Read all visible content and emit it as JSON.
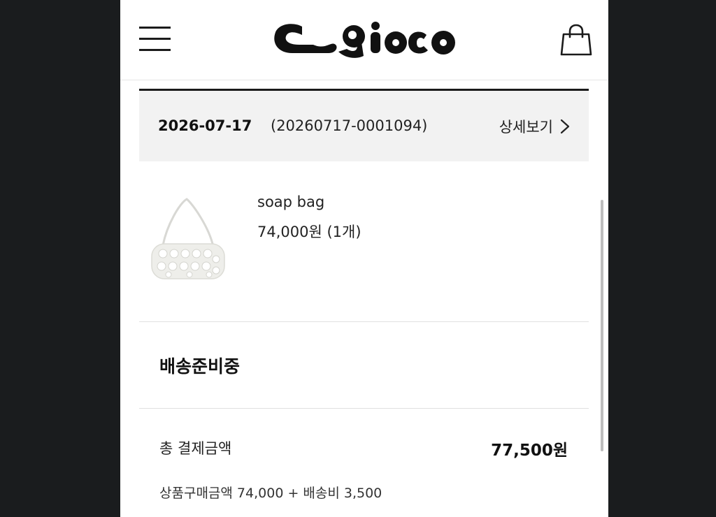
{
  "header": {
    "logo_text": "c_gioco",
    "menu_icon": "hamburger-menu-icon",
    "cart_icon": "shopping-bag-icon"
  },
  "order": {
    "date": "2026-07-17",
    "number": "(20260717-0001094)",
    "detail_link": "상세보기",
    "detail_icon": "chevron-right-icon"
  },
  "product": {
    "name": "soap bag",
    "price": "74,000원 (1개)",
    "image_icon": "shoulder-bag-thumbnail"
  },
  "status": {
    "label": "배송준비중"
  },
  "payment": {
    "total_label": "총 결제금액",
    "total_value": "77,500원",
    "breakdown": "상품구매금액 74,000 + 배송비 3,500"
  },
  "colors": {
    "background": "#1a1c1e",
    "panel": "#ffffff",
    "order_header_bg": "#f2f2f2",
    "text": "#222222"
  }
}
